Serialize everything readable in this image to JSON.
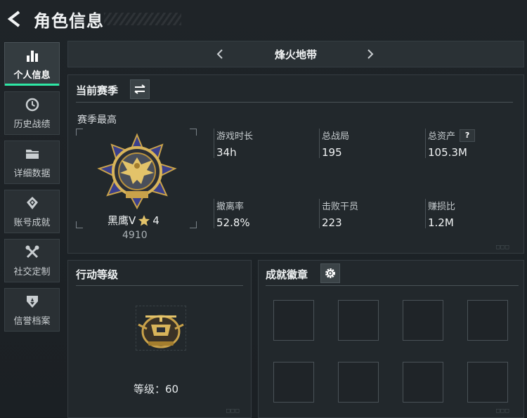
{
  "header": {
    "title": "角色信息"
  },
  "sidebar": {
    "items": [
      {
        "label": "个人信息",
        "icon": "bar-chart-icon",
        "active": true
      },
      {
        "label": "历史战绩",
        "icon": "history-icon",
        "active": false
      },
      {
        "label": "详细数据",
        "icon": "folder-icon",
        "active": false
      },
      {
        "label": "账号成就",
        "icon": "achievement-icon",
        "active": false
      },
      {
        "label": "社交定制",
        "icon": "tools-icon",
        "active": false
      },
      {
        "label": "信誉档案",
        "icon": "reputation-icon",
        "active": false
      }
    ]
  },
  "season_selector": {
    "name": "烽火地带"
  },
  "current_season": {
    "title": "当前赛季",
    "subtitle": "赛季最高",
    "rank": {
      "name": "黑鹰V",
      "stars": "4",
      "score": "4910"
    },
    "stats": [
      {
        "label": "游戏时长",
        "value": "34h"
      },
      {
        "label": "总战局",
        "value": "195"
      },
      {
        "label": "总资产",
        "value": "105.3M",
        "help": "?"
      },
      {
        "label": "撤离率",
        "value": "52.8%"
      },
      {
        "label": "击败干员",
        "value": "223"
      },
      {
        "label": "赚损比",
        "value": "1.2M"
      }
    ]
  },
  "action_level": {
    "title": "行动等级",
    "level_text": "等级：60"
  },
  "achievement_badges": {
    "title": "成就徽章"
  },
  "colors": {
    "accent": "#2ee8a5",
    "gold": "#c9a24a",
    "panel": "#22282c"
  }
}
